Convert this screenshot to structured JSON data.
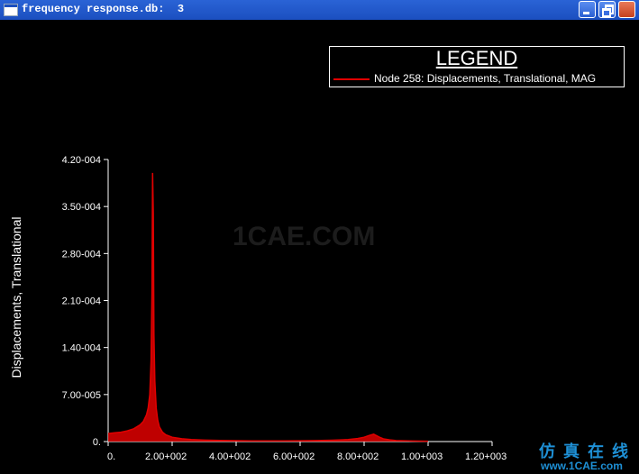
{
  "window": {
    "title": "frequency response.db:  3",
    "buttons": {
      "minimize": "minimize",
      "restore": "restore",
      "close": "close"
    }
  },
  "legend": {
    "title": "LEGEND",
    "entries": [
      {
        "label": "Node 258: Displacements, Translational, MAG",
        "color": "#e00000"
      }
    ]
  },
  "watermark": "1CAE.COM",
  "logo": {
    "text_cn": "仿真在线",
    "text_en": "www.1CAE.com"
  },
  "chart_data": {
    "type": "line",
    "title": "",
    "xlabel": "",
    "ylabel": "Displacements, Translational",
    "xlim": [
      0,
      1200
    ],
    "ylim": [
      0,
      0.00042
    ],
    "x_ticks": [
      0,
      200,
      400,
      600,
      800,
      1000,
      1200
    ],
    "x_tick_labels": [
      "0.",
      "2.00+002",
      "4.00+002",
      "6.00+002",
      "8.00+002",
      "1.00+003",
      "1.20+003"
    ],
    "y_ticks": [
      0,
      7e-05,
      0.00014,
      0.00021,
      0.00028,
      0.00035,
      0.00042
    ],
    "y_tick_labels": [
      "0.",
      "7.00-005",
      "1.40-004",
      "2.10-004",
      "2.80-004",
      "3.50-004",
      "4.20-004"
    ],
    "grid": false,
    "legend_position": "top-right",
    "series": [
      {
        "name": "Node 258: Displacements, Translational, MAG",
        "color": "#e00000",
        "x": [
          0,
          20,
          40,
          60,
          80,
          100,
          110,
          120,
          125,
          130,
          134,
          137,
          139,
          141,
          143,
          146,
          150,
          155,
          160,
          170,
          180,
          200,
          230,
          260,
          300,
          350,
          400,
          450,
          500,
          550,
          600,
          650,
          700,
          750,
          780,
          800,
          815,
          830,
          840,
          850,
          860,
          880,
          900,
          950,
          1000
        ],
        "y": [
          1.2e-05,
          1.3e-05,
          1.4e-05,
          1.6e-05,
          1.9e-05,
          2.5e-05,
          3e-05,
          4e-05,
          5e-05,
          7e-05,
          0.00012,
          0.00022,
          0.0004,
          0.00034,
          0.00016,
          9e-05,
          5e-05,
          3.2e-05,
          2.2e-05,
          1.4e-05,
          1e-05,
          6.5e-06,
          4.2e-06,
          3e-06,
          2.2e-06,
          1.6e-06,
          1.3e-06,
          1.1e-06,
          1e-06,
          1e-06,
          1.2e-06,
          1.5e-06,
          2e-06,
          3e-06,
          4.5e-06,
          6.5e-06,
          9e-06,
          1.1e-05,
          8.5e-06,
          6e-06,
          4e-06,
          2.5e-06,
          1.5e-06,
          8e-07,
          5e-07
        ]
      }
    ]
  }
}
